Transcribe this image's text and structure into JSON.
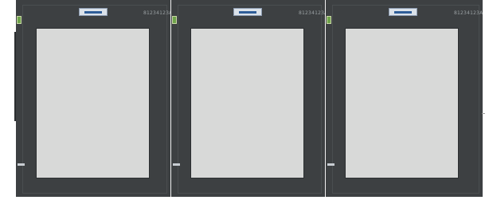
{
  "panels": [
    {
      "code": "81234123A"
    },
    {
      "code": "81234123A"
    },
    {
      "code": "81234123A"
    }
  ]
}
